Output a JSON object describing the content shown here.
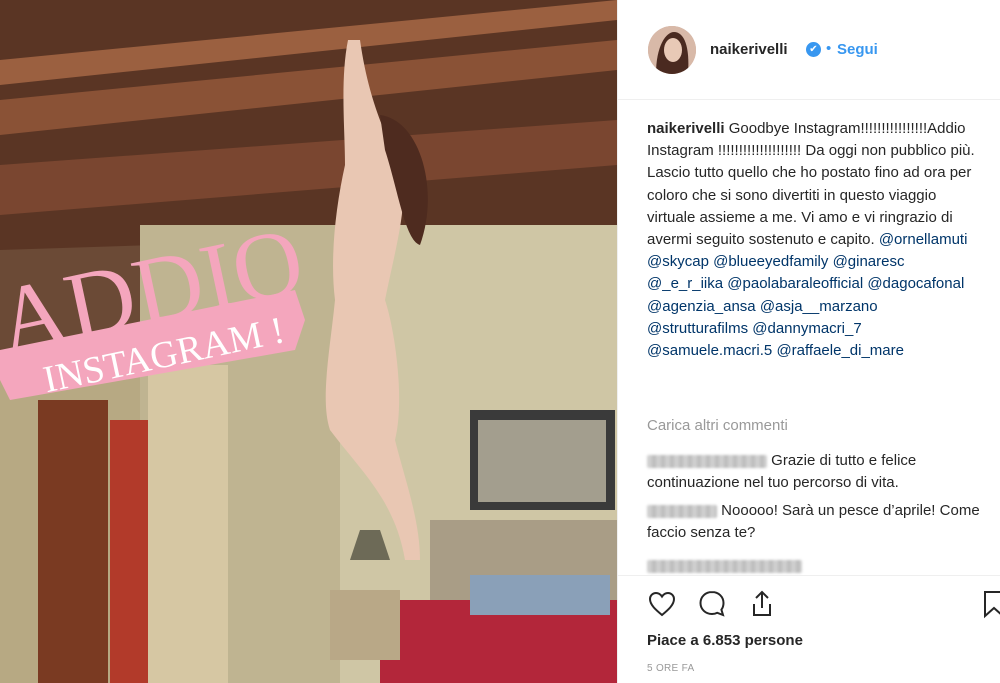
{
  "post": {
    "username": "naikerivelli",
    "follow_label": "Segui",
    "follow_separator": "•",
    "verified_mark": "✔",
    "overlay_text_1": "ADDIO",
    "overlay_text_2": "INSTAGRAM !",
    "caption_text_1": "Goodbye Instagram!!!!!!!!!!!!!!!!Addio Instagram !!!!!!!!!!!!!!!!!!!! Da oggi non pubblico più. Lascio tutto quello che ho postato fino ad ora per coloro che si sono divertiti in questo viaggio virtuale assieme a me. Vi amo e vi ringrazio di avermi seguito sostenuto e capito.",
    "mentions": [
      "@ornellamuti",
      "@skycap",
      "@blueeyedfamily",
      "@ginaresc",
      "@_e_r_iika",
      "@paolabaraleofficial",
      "@dagocafonal",
      "@agenzia_ansa",
      "@asja__marzano",
      "@strutturafilms",
      "@dannymacri_7",
      "@samuele.macri.5",
      "@raffaele_di_mare"
    ],
    "load_more_label": "Carica altri commenti",
    "comments": [
      {
        "text": "Grazie di tutto e felice continuazione nel tuo percorso di vita."
      },
      {
        "text": "Nooooo! Sarà un pesce d’aprile! Come faccio senza te?"
      }
    ],
    "likes_text": "Piace a 6.853 persone",
    "time_text": "5 ORE FA"
  },
  "icons": [
    "heart-icon",
    "comment-icon",
    "share-icon",
    "bookmark-icon",
    "verified-badge-icon"
  ],
  "colors": {
    "accent": "#3897f0",
    "mention": "#003569",
    "muted": "#999999",
    "overlay_pink": "#f4a6bd"
  }
}
